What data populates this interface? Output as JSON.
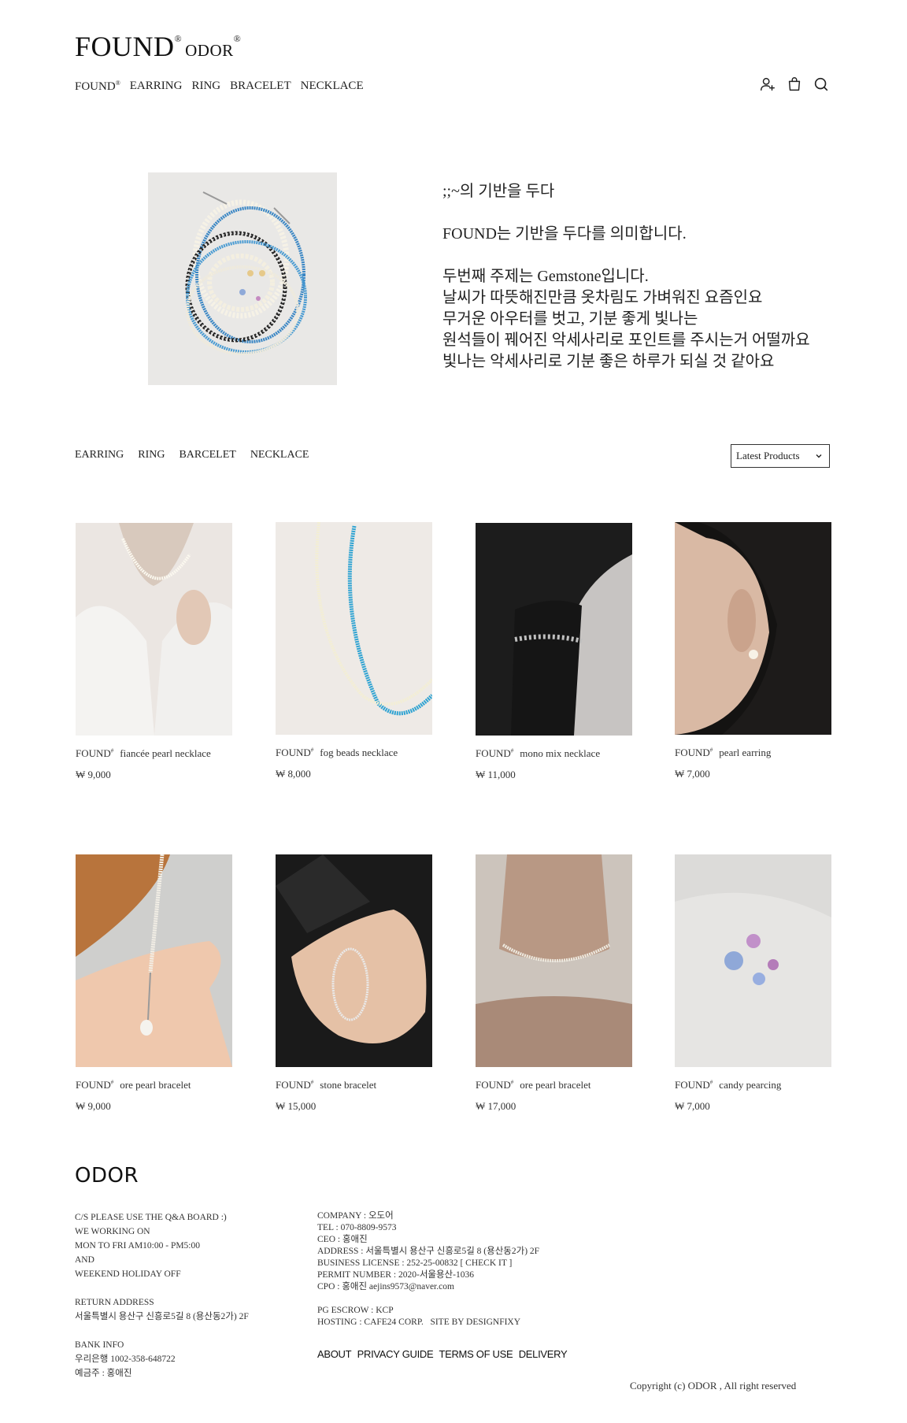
{
  "header": {
    "logo_main": "FOUND",
    "logo_mark": "®",
    "logo_sub": "ODOR",
    "nav": [
      {
        "label": "FOUND",
        "mark": "®"
      },
      {
        "label": "EARRING"
      },
      {
        "label": "RING"
      },
      {
        "label": "BRACELET"
      },
      {
        "label": "NECKLACE"
      }
    ],
    "icons": [
      "user-add-icon",
      "shopping-bag-icon",
      "search-icon"
    ]
  },
  "intro": {
    "lines": [
      ";;~의 기반을 두다",
      "",
      "FOUND는 기반을 두다를 의미합니다.",
      "",
      "두번째 주제는 Gemstone입니다.",
      "날씨가 따뜻해진만큼 옷차림도 가벼워진 요즘인요",
      "무거운 아우터를 벗고, 기분 좋게 빛나는",
      "원석들이 꿰어진 악세사리로 포인트를 주시는거 어떨까요",
      "빛나는 악세사리로 기분 좋은 하루가 되실 것 같아요"
    ]
  },
  "filters": {
    "categories": [
      "EARRING",
      "RING",
      "BARCELET",
      "NECKLACE"
    ],
    "sort_selected": "Latest Products"
  },
  "products": [
    {
      "brand": "FOUND",
      "mark": "#",
      "name": "fiancée pearl necklace",
      "price": "₩ 9,000"
    },
    {
      "brand": "FOUND",
      "mark": "#",
      "name": "fog beads necklace",
      "price": "₩ 8,000"
    },
    {
      "brand": "FOUND",
      "mark": "#",
      "name": "mono mix necklace",
      "price": "₩ 11,000"
    },
    {
      "brand": "FOUND",
      "mark": "#",
      "name": "pearl earring",
      "price": "₩ 7,000"
    },
    {
      "brand": "FOUND",
      "mark": "#",
      "name": "ore pearl bracelet",
      "price": "₩ 9,000"
    },
    {
      "brand": "FOUND",
      "mark": "#",
      "name": "stone bracelet",
      "price": "₩ 15,000"
    },
    {
      "brand": "FOUND",
      "mark": "#",
      "name": "ore pearl bracelet",
      "price": "₩ 17,000"
    },
    {
      "brand": "FOUND",
      "mark": "#",
      "name": "candy pearcing",
      "price": "₩ 7,000"
    }
  ],
  "footer": {
    "brand": "ODOR",
    "left_col": [
      "C/S PLEASE USE THE Q&A BOARD :)",
      "WE WORKING ON",
      "MON TO FRI AM10:00 - PM5:00",
      "AND",
      "WEEKEND HOLIDAY OFF",
      "",
      "RETURN ADDRESS",
      "서울특별시 용산구 신흥로5길 8 (용산동2가) 2F",
      "",
      "BANK INFO",
      "우리은행 1002-358-648722",
      "예금주 : 홍애진"
    ],
    "right_col": [
      "COMPANY : 오도어",
      "TEL : 070-8809-9573",
      "CEO : 홍애진",
      "ADDRESS : 서울특별시 용산구 신흥로5길 8 (용산동2가) 2F",
      "BUSINESS LICENSE : 252-25-00832 [ CHECK IT ]",
      "PERMIT NUMBER : 2020-서울용산-1036",
      "CPO : 홍애진 aejins9573@naver.com",
      "",
      "PG ESCROW : KCP",
      "HOSTING : CAFE24 CORP.   SITE BY DESIGNFIXY"
    ],
    "links": [
      "ABOUT",
      "PRIVACY GUIDE",
      "TERMS OF USE",
      "DELIVERY"
    ],
    "copyright": "Copyright (c) ODOR , All right reserved"
  }
}
